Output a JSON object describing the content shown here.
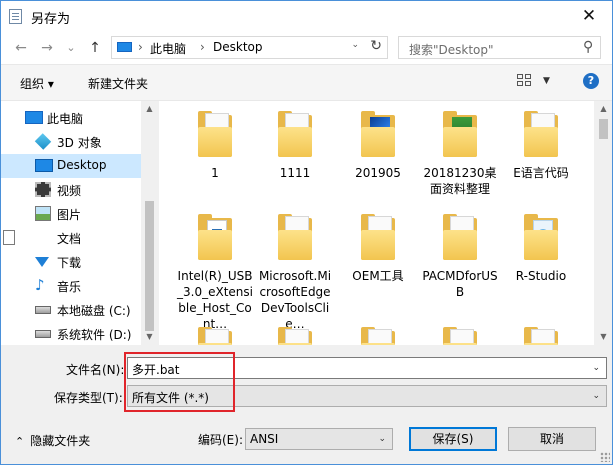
{
  "window": {
    "title": "另存为",
    "close_glyph": "✕"
  },
  "address": {
    "back_glyph": "←",
    "forward_glyph": "→",
    "recent_glyph": "⌄",
    "up_glyph": "↑",
    "segments": [
      "此电脑",
      "Desktop"
    ],
    "separator": "›",
    "dropdown_glyph": "⌄",
    "refresh_glyph": "↻"
  },
  "search": {
    "placeholder": "搜索\"Desktop\"",
    "icon_glyph": "⚲"
  },
  "toolbar": {
    "organize_label": "组织 ▾",
    "new_folder_label": "新建文件夹",
    "view_drop_glyph": "▼",
    "help_glyph": "?"
  },
  "nav": {
    "items": [
      {
        "label": "此电脑",
        "icon": "pc-icon"
      },
      {
        "label": "3D 对象",
        "icon": "cube-icon"
      },
      {
        "label": "Desktop",
        "icon": "desktop-icon",
        "selected": true
      },
      {
        "label": "视频",
        "icon": "video-icon"
      },
      {
        "label": "图片",
        "icon": "picture-icon"
      },
      {
        "label": "文档",
        "icon": "document-icon"
      },
      {
        "label": "下载",
        "icon": "download-icon"
      },
      {
        "label": "音乐",
        "icon": "music-icon"
      },
      {
        "label": "本地磁盘 (C:)",
        "icon": "drive-icon"
      },
      {
        "label": "系统软件 (D:)",
        "icon": "drive-icon"
      }
    ],
    "scroll_up_glyph": "▲",
    "scroll_down_glyph": "▼"
  },
  "files": [
    {
      "label": "1",
      "kind": "plain"
    },
    {
      "label": "1111",
      "kind": "paper"
    },
    {
      "label": "201905",
      "kind": "blue-image"
    },
    {
      "label": "20181230桌面资料整理",
      "kind": "green-image"
    },
    {
      "label": "E语言代码",
      "kind": "paper"
    },
    {
      "label": "Intel(R)_USB_3.0_eXtensible_Host_Cont…",
      "kind": "installer"
    },
    {
      "label": "Microsoft.MicrosoftEdgeDevToolsClie…",
      "kind": "plain"
    },
    {
      "label": "OEM工具",
      "kind": "paper"
    },
    {
      "label": "PACMDforUSB",
      "kind": "paper"
    },
    {
      "label": "R-Studio",
      "kind": "rstudio"
    },
    {
      "label": "",
      "kind": "plain"
    },
    {
      "label": "",
      "kind": "plain"
    },
    {
      "label": "",
      "kind": "plain"
    },
    {
      "label": "",
      "kind": "plain"
    },
    {
      "label": "",
      "kind": "plain"
    }
  ],
  "form": {
    "filename_label": "文件名(N):",
    "filename_value": "多开.bat",
    "filetype_label": "保存类型(T):",
    "filetype_value": "所有文件  (*.*)",
    "combo_arrow": "⌄",
    "hide_folders_label": "隐藏文件夹",
    "hide_folders_glyph": "⌃",
    "encoding_label": "编码(E):",
    "encoding_value": "ANSI",
    "save_label": "保存(S)",
    "cancel_label": "取消"
  },
  "colors": {
    "accent": "#0078d7",
    "highlight_box": "#e0252b",
    "selection": "#cce8ff",
    "folder": "#f2c54f"
  }
}
